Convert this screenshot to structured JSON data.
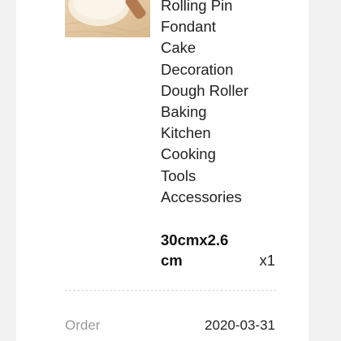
{
  "product": {
    "image_icon": "product-photo-rolling-pin",
    "title": "Rolling Pin\nFondant\nCake\nDecoration\nDough Roller\nBaking\nKitchen\nCooking\nTools\nAccessories",
    "variant": "30cmx2.6\ncm",
    "quantity": "x1"
  },
  "order": {
    "label": "Order",
    "date": "2020-03-31"
  }
}
